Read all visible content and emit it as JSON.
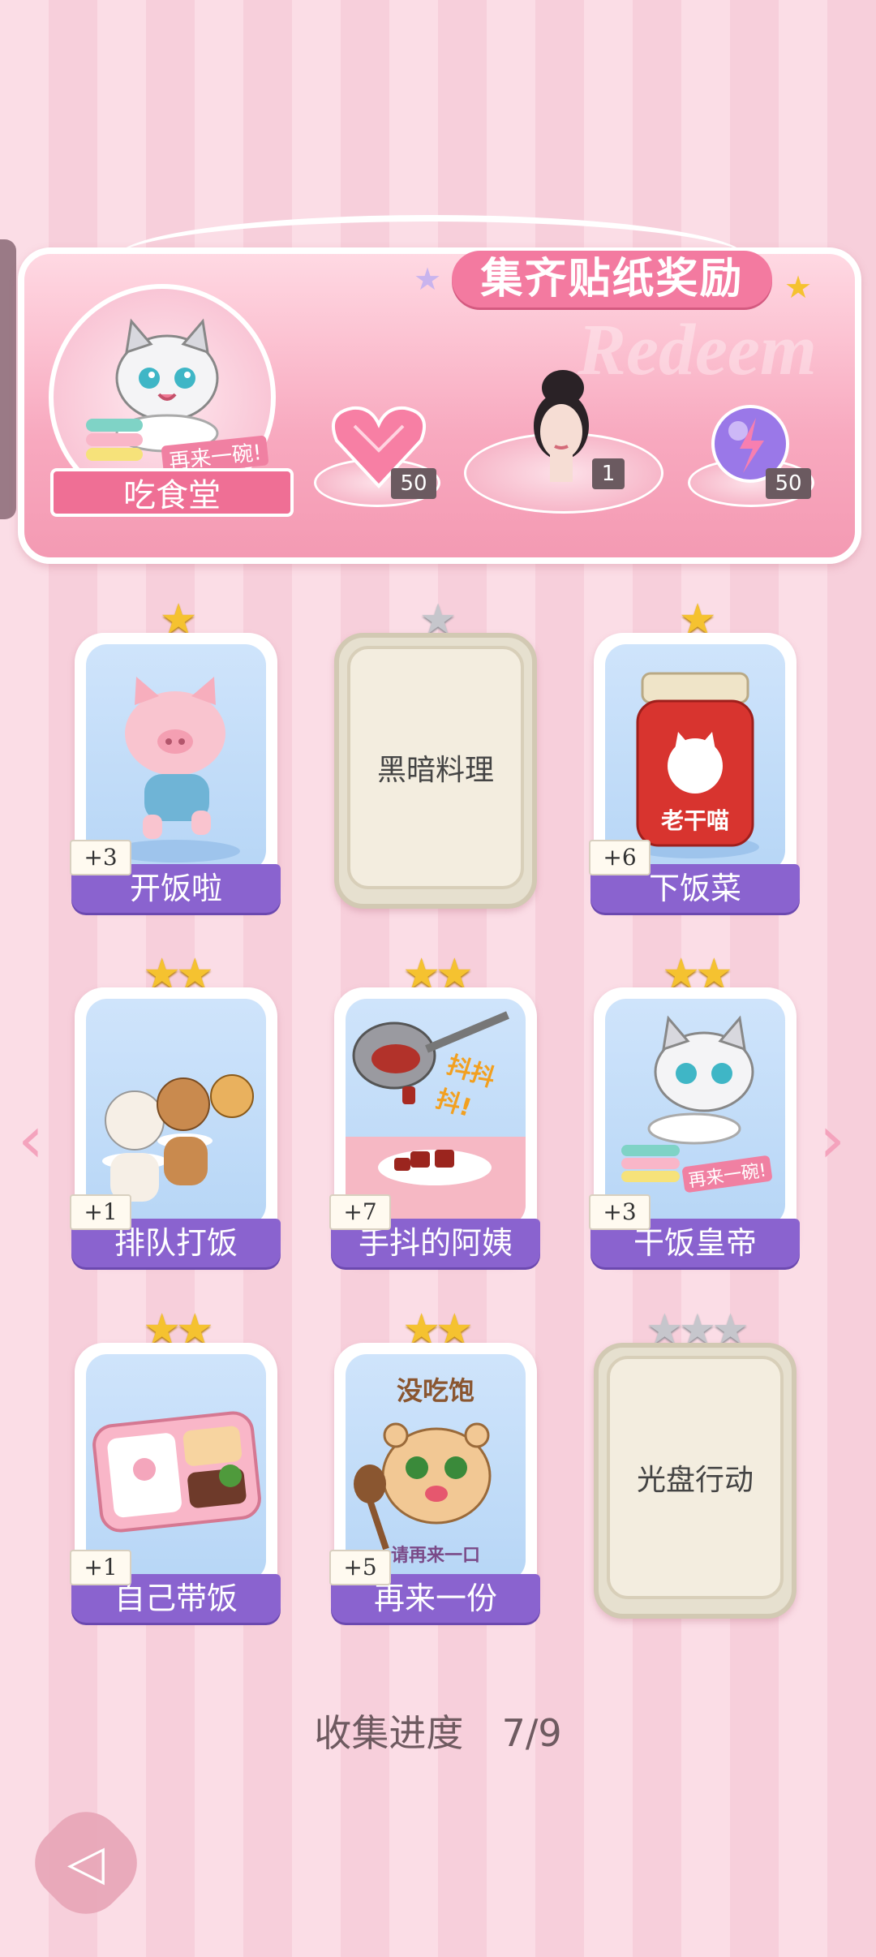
{
  "banner": {
    "title": "集齐贴纸奖励",
    "badge_ribbon": "吃食堂",
    "badge_caption": "再来一碗!",
    "watermark": "Redeem",
    "rewards": [
      {
        "icon": "pink-heart-gem-icon",
        "count": "50"
      },
      {
        "icon": "avatar-portrait-icon",
        "count": "1"
      },
      {
        "icon": "lightning-orb-icon",
        "count": "50"
      }
    ]
  },
  "cards": [
    {
      "name": "开饭啦",
      "bonus": "+3",
      "stars": 1,
      "collected": true,
      "art": "running-pig"
    },
    {
      "name": "黑暗料理",
      "bonus": "",
      "stars": 1,
      "collected": false,
      "art": ""
    },
    {
      "name": "下饭菜",
      "bonus": "+6",
      "stars": 1,
      "collected": true,
      "art": "chili-jar",
      "art_text": "老干喵"
    },
    {
      "name": "排队打饭",
      "bonus": "+1",
      "stars": 2,
      "collected": true,
      "art": "queueing-cats"
    },
    {
      "name": "手抖的阿姨",
      "bonus": "+7",
      "stars": 2,
      "collected": true,
      "art": "shaking-ladle",
      "art_text": "抖抖抖!"
    },
    {
      "name": "干饭皇帝",
      "bonus": "+3",
      "stars": 2,
      "collected": true,
      "art": "eating-cat",
      "art_text": "再来一碗!"
    },
    {
      "name": "自己带饭",
      "bonus": "+1",
      "stars": 2,
      "collected": true,
      "art": "bento-box"
    },
    {
      "name": "再来一份",
      "bonus": "+5",
      "stars": 2,
      "collected": true,
      "art": "hungry-hamster",
      "art_text": "没吃饱",
      "art_text2": "请再来一口"
    },
    {
      "name": "光盘行动",
      "bonus": "",
      "stars": 3,
      "collected": false,
      "art": ""
    }
  ],
  "progress": {
    "label": "收集进度",
    "value": "7/9"
  },
  "colors": {
    "accent_pink": "#f37aa0",
    "card_label_purple": "#8a63cf",
    "star_gold": "#f5c230",
    "star_grey": "#c6c6cc"
  }
}
